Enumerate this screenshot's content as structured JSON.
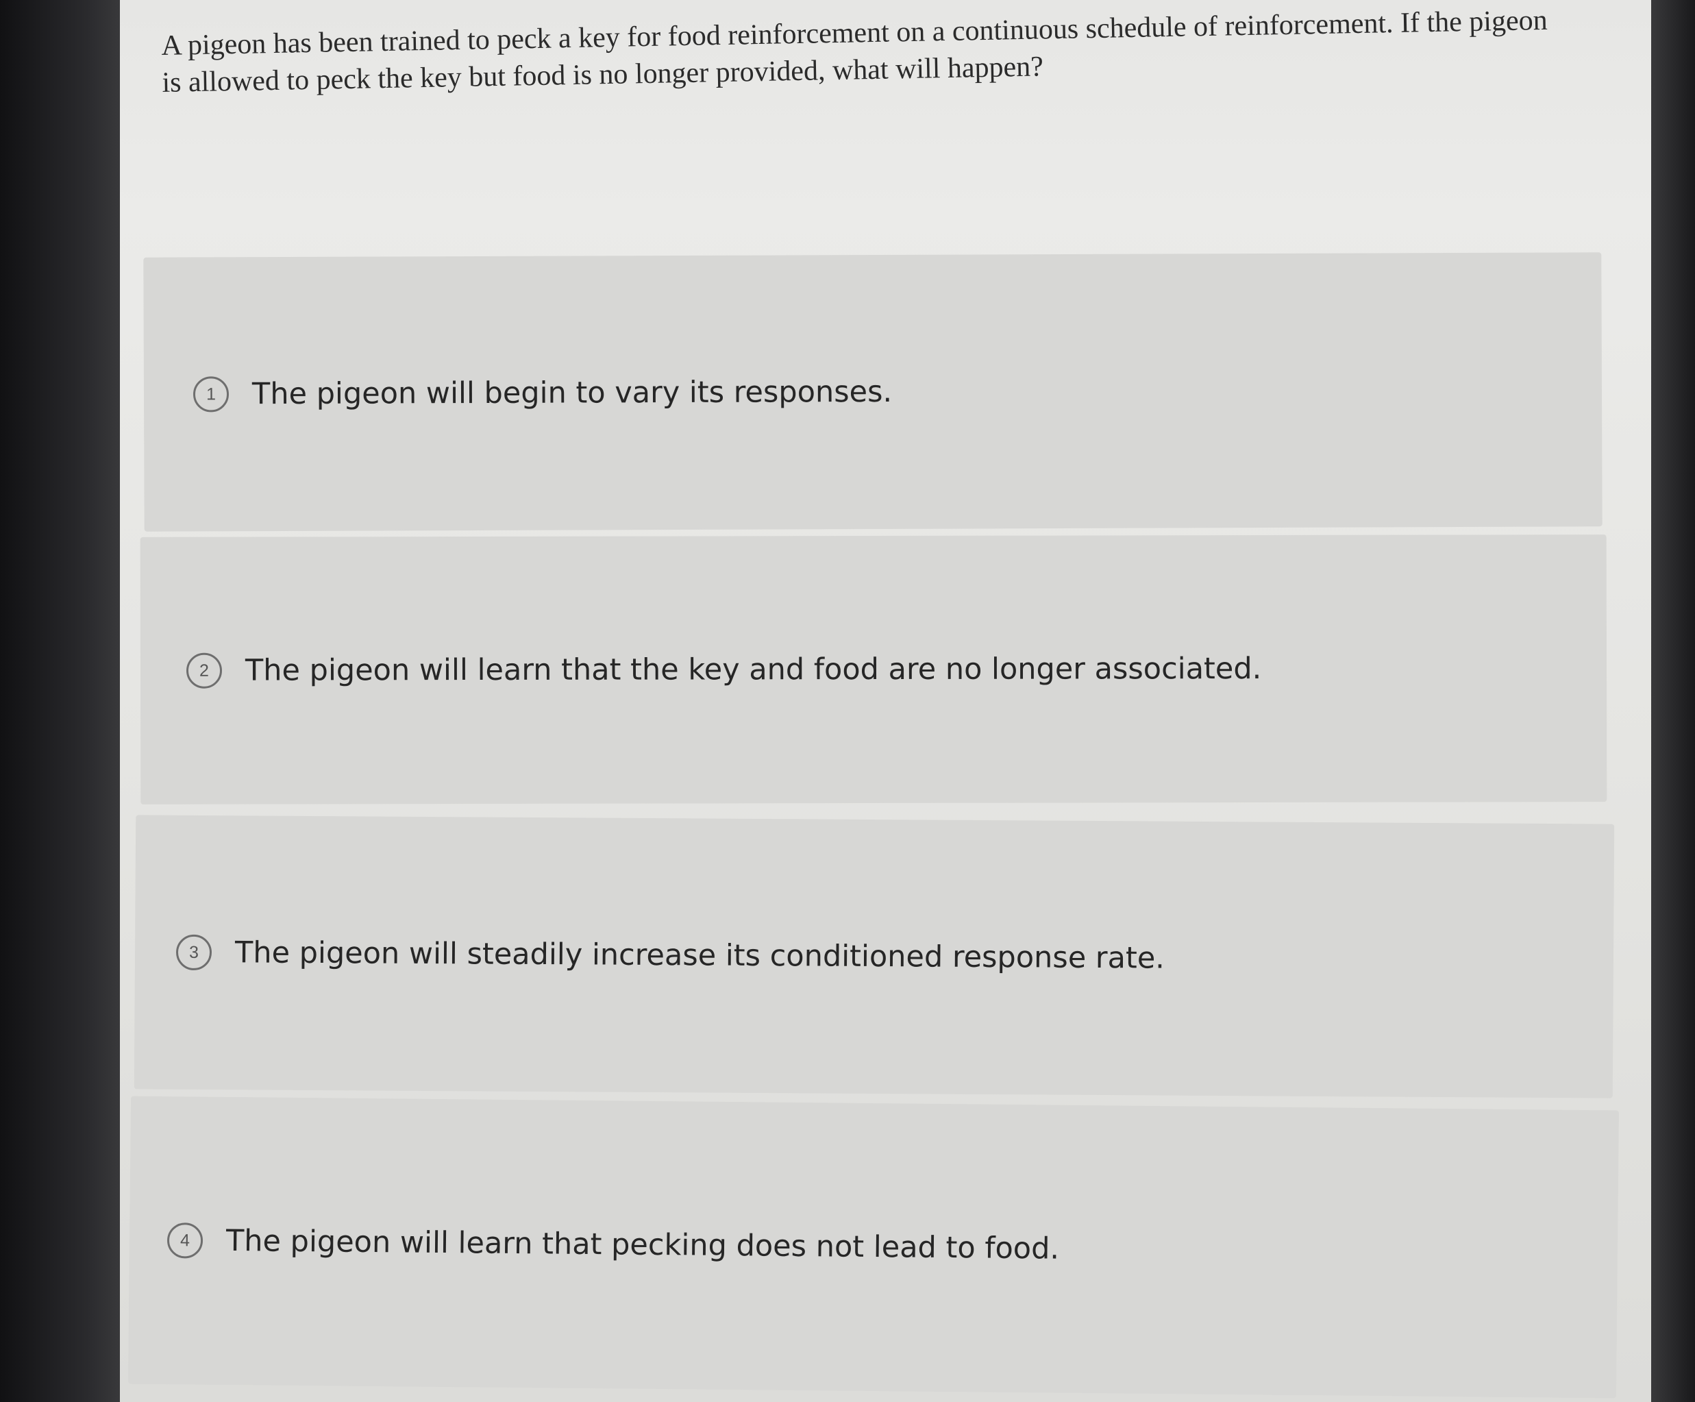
{
  "question": {
    "text": "A pigeon has been trained to peck a key for food reinforcement on a continuous schedule of reinforcement. If the pigeon is allowed to peck the key but food is no longer provided, what will happen?"
  },
  "options": [
    {
      "number": "1",
      "label": "The pigeon will begin to vary its responses."
    },
    {
      "number": "2",
      "label": "The pigeon will learn that the key and food are no longer associated."
    },
    {
      "number": "3",
      "label": "The pigeon will steadily increase its conditioned response rate."
    },
    {
      "number": "4",
      "label": "The pigeon will learn that pecking does not lead to food."
    }
  ]
}
